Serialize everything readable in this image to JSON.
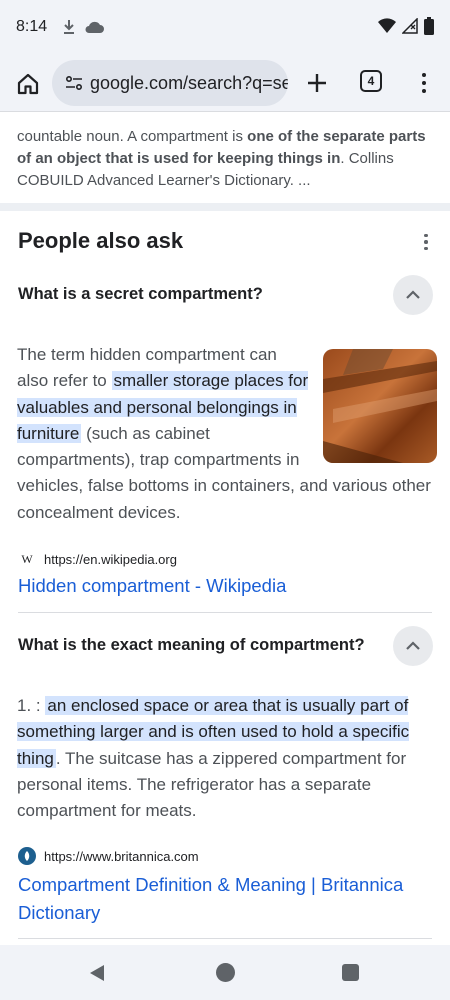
{
  "status_bar": {
    "time": "8:14",
    "icons": [
      "download-icon",
      "cloud-icon",
      "wifi-icon",
      "signal-icon",
      "battery-icon"
    ]
  },
  "toolbar": {
    "url": "google.com/search?q=sec",
    "tab_count": "4",
    "icons": [
      "home-icon",
      "site-info-icon",
      "new-tab-plus-icon",
      "menu-dots-icon"
    ]
  },
  "snippet": {
    "text_before": "countable noun. A compartment is ",
    "text_bold": "one of the separate parts of an object that is used for keeping things in",
    "text_after": ". Collins COBUILD Advanced Learner's Dictionary. ..."
  },
  "paa": {
    "title": "People also ask",
    "questions": [
      {
        "question": "What is a secret compartment?",
        "answer_before": "The term hidden compartment can also refer to ",
        "answer_highlight": "smaller storage places for valuables and personal belongings in furniture",
        "answer_after": " (such as cabinet compartments), trap compartments in vehicles, false bottoms in containers, and various other concealment devices.",
        "source_url": "https://en.wikipedia.org",
        "source_fav": "W",
        "link": "Hidden compartment - Wikipedia"
      },
      {
        "question": "What is the exact meaning of compartment?",
        "answer_before": "1. : ",
        "answer_highlight": "an enclosed space or area that is usually part of something larger and is often used to hold a specific thing",
        "answer_after": ". The suitcase has a zippered compartment for personal items. The refrigerator has a separate compartment for meats.",
        "source_url": "https://www.britannica.com",
        "link": "Compartment Definition & Meaning | Britannica Dictionary"
      }
    ]
  },
  "colors": {
    "link": "#1a5ed6",
    "highlight": "#d3e3fd",
    "chrome_bg": "#f1f3f8"
  }
}
